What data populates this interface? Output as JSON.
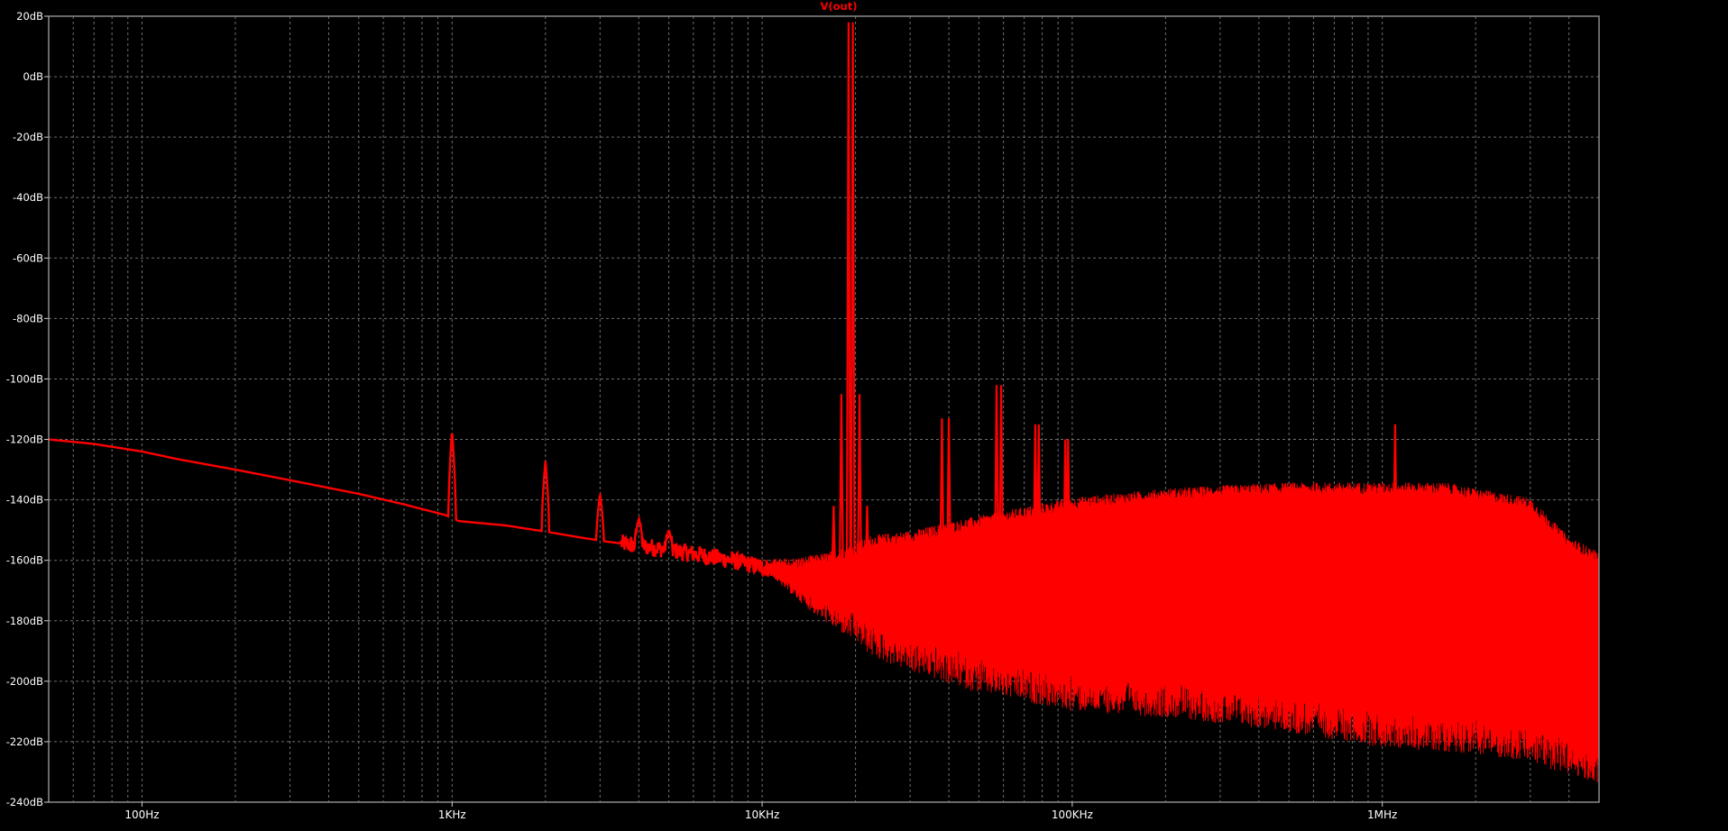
{
  "chart_data": {
    "type": "line",
    "title": "V(out)",
    "x_scale": "log",
    "xlim_hz": [
      50,
      5000000
    ],
    "ylim_db": [
      -240,
      20
    ],
    "grid": true,
    "x_tick_labels": [
      {
        "value": 100,
        "label": "100Hz"
      },
      {
        "value": 1000,
        "label": "1KHz"
      },
      {
        "value": 10000,
        "label": "10KHz"
      },
      {
        "value": 100000,
        "label": "100KHz"
      },
      {
        "value": 1000000,
        "label": "1MHz"
      }
    ],
    "y_tick_labels": [
      {
        "value": 20,
        "label": "20dB"
      },
      {
        "value": 0,
        "label": "0dB"
      },
      {
        "value": -20,
        "label": "-20dB"
      },
      {
        "value": -40,
        "label": "-40dB"
      },
      {
        "value": -60,
        "label": "-60dB"
      },
      {
        "value": -80,
        "label": "-80dB"
      },
      {
        "value": -100,
        "label": "-100dB"
      },
      {
        "value": -120,
        "label": "-120dB"
      },
      {
        "value": -140,
        "label": "-140dB"
      },
      {
        "value": -160,
        "label": "-160dB"
      },
      {
        "value": -180,
        "label": "-180dB"
      },
      {
        "value": -200,
        "label": "-200dB"
      },
      {
        "value": -220,
        "label": "-220dB"
      },
      {
        "value": -240,
        "label": "-240dB"
      }
    ],
    "series": [
      {
        "name": "V(out)",
        "color": "#ff0000",
        "baseline": [
          [
            50,
            -120
          ],
          [
            70,
            -121.5
          ],
          [
            100,
            -124
          ],
          [
            130,
            -126.5
          ],
          [
            200,
            -130
          ],
          [
            300,
            -133.5
          ],
          [
            500,
            -138
          ],
          [
            700,
            -141.5
          ],
          [
            950,
            -145
          ],
          [
            1050,
            -147
          ],
          [
            1500,
            -148.5
          ],
          [
            2000,
            -150.5
          ],
          [
            3000,
            -153.5
          ],
          [
            5000,
            -156.5
          ],
          [
            8000,
            -160
          ],
          [
            12000,
            -164
          ],
          [
            20000,
            -170
          ],
          [
            30000,
            -168
          ],
          [
            50000,
            -166
          ],
          [
            80000,
            -164
          ],
          [
            100000,
            -163
          ],
          [
            200000,
            -162
          ],
          [
            300000,
            -163
          ],
          [
            500000,
            -164
          ],
          [
            1000000,
            -165
          ],
          [
            2000000,
            -166
          ],
          [
            5000000,
            -168
          ]
        ],
        "envelope_upper": [
          [
            20000,
            -155
          ],
          [
            30000,
            -153
          ],
          [
            50000,
            -148
          ],
          [
            100000,
            -142
          ],
          [
            200000,
            -139
          ],
          [
            300000,
            -138
          ],
          [
            500000,
            -137
          ],
          [
            800000,
            -137
          ],
          [
            1200000,
            -137
          ],
          [
            1600000,
            -137
          ],
          [
            2000000,
            -139
          ],
          [
            3000000,
            -142
          ],
          [
            4000000,
            -155
          ],
          [
            5000000,
            -160
          ]
        ],
        "envelope_lower": [
          [
            20000,
            -178
          ],
          [
            30000,
            -185
          ],
          [
            50000,
            -192
          ],
          [
            100000,
            -198
          ],
          [
            200000,
            -200
          ],
          [
            300000,
            -202
          ],
          [
            500000,
            -205
          ],
          [
            1000000,
            -210
          ],
          [
            2000000,
            -212
          ],
          [
            3000000,
            -215
          ],
          [
            4000000,
            -219
          ],
          [
            5000000,
            -222
          ]
        ],
        "peaks": [
          {
            "f": 1000,
            "db": -117
          },
          {
            "f": 2000,
            "db": -127
          },
          {
            "f": 3000,
            "db": -138
          },
          {
            "f": 4000,
            "db": -146
          },
          {
            "f": 5000,
            "db": -150
          },
          {
            "f": 19000,
            "db": 18
          },
          {
            "f": 19600,
            "db": 18
          },
          {
            "f": 18000,
            "db": -105
          },
          {
            "f": 20600,
            "db": -105
          },
          {
            "f": 17000,
            "db": -142
          },
          {
            "f": 21800,
            "db": -142
          },
          {
            "f": 38000,
            "db": -113
          },
          {
            "f": 40000,
            "db": -113
          },
          {
            "f": 57000,
            "db": -102
          },
          {
            "f": 59000,
            "db": -102
          },
          {
            "f": 76000,
            "db": -115
          },
          {
            "f": 78000,
            "db": -115
          },
          {
            "f": 95000,
            "db": -120
          },
          {
            "f": 97000,
            "db": -120
          },
          {
            "f": 1100000,
            "db": -115
          }
        ],
        "floor_minima": [
          {
            "f": 130000,
            "db": -210
          },
          {
            "f": 500000,
            "db": -210
          },
          {
            "f": 1500000,
            "db": -219
          },
          {
            "f": 4500000,
            "db": -232
          }
        ]
      }
    ]
  }
}
